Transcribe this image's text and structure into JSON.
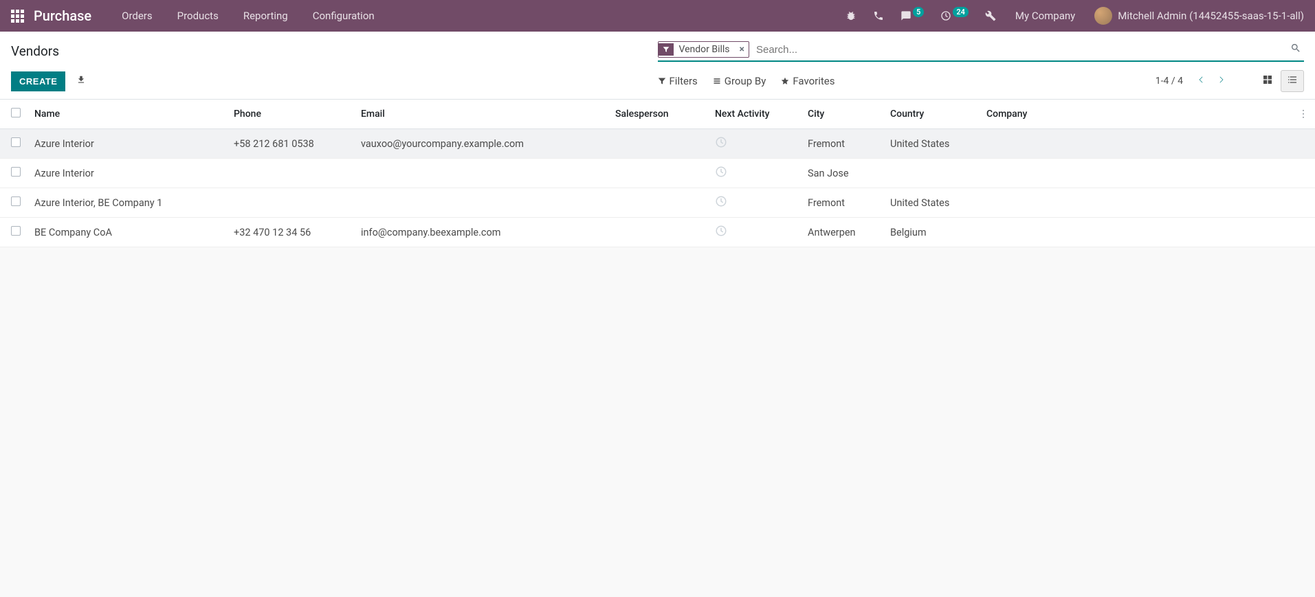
{
  "navbar": {
    "brand": "Purchase",
    "menu": [
      "Orders",
      "Products",
      "Reporting",
      "Configuration"
    ],
    "badges": {
      "messages": "5",
      "activities": "24"
    },
    "company": "My Company",
    "user": "Mitchell Admin (14452455-saas-15-1-all)"
  },
  "control_panel": {
    "breadcrumb": "Vendors",
    "create_label": "CREATE",
    "search": {
      "facet_label": "Vendor Bills",
      "placeholder": "Search..."
    },
    "options": {
      "filters": "Filters",
      "group_by": "Group By",
      "favorites": "Favorites"
    },
    "pager": "1-4 / 4"
  },
  "table": {
    "headers": {
      "name": "Name",
      "phone": "Phone",
      "email": "Email",
      "salesperson": "Salesperson",
      "next_activity": "Next Activity",
      "city": "City",
      "country": "Country",
      "company": "Company"
    },
    "rows": [
      {
        "name": "Azure Interior",
        "phone": "+58 212 681 0538",
        "email": "vauxoo@yourcompany.example.com",
        "salesperson": "",
        "city": "Fremont",
        "country": "United States",
        "company": ""
      },
      {
        "name": "Azure Interior",
        "phone": "",
        "email": "",
        "salesperson": "",
        "city": "San Jose",
        "country": "",
        "company": ""
      },
      {
        "name": "Azure Interior, BE Company 1",
        "phone": "",
        "email": "",
        "salesperson": "",
        "city": "Fremont",
        "country": "United States",
        "company": ""
      },
      {
        "name": "BE Company CoA",
        "phone": "+32 470 12 34 56",
        "email": "info@company.beexample.com",
        "salesperson": "",
        "city": "Antwerpen",
        "country": "Belgium",
        "company": ""
      }
    ]
  }
}
